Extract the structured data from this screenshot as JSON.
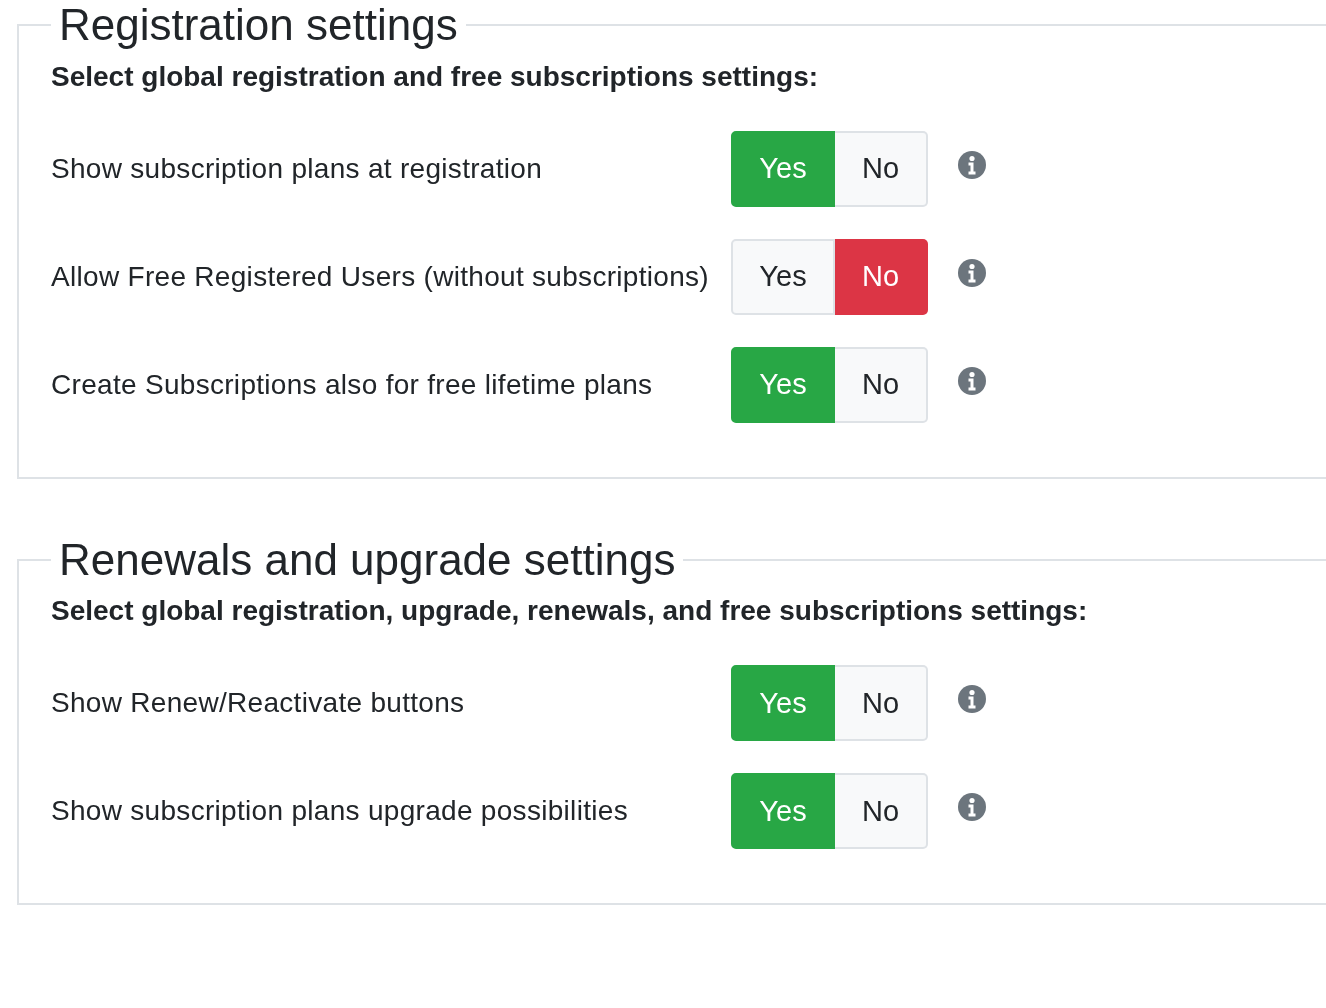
{
  "sections": [
    {
      "title": "Registration settings",
      "subtitle": "Select global registration and free subscriptions settings:",
      "settings": [
        {
          "label": "Show subscription plans at registration",
          "options": [
            {
              "label": "Yes",
              "kind": "yes",
              "selected": true
            },
            {
              "label": "No",
              "kind": "no",
              "selected": false
            }
          ]
        },
        {
          "label": "Allow Free Registered Users (without subscriptions)",
          "options": [
            {
              "label": "Yes",
              "kind": "yes",
              "selected": false
            },
            {
              "label": "No",
              "kind": "no",
              "selected": true
            }
          ]
        },
        {
          "label": "Create Subscriptions also for free lifetime plans",
          "options": [
            {
              "label": "Yes",
              "kind": "yes",
              "selected": true
            },
            {
              "label": "No",
              "kind": "no",
              "selected": false
            }
          ]
        }
      ]
    },
    {
      "title": "Renewals and upgrade settings",
      "subtitle": "Select global registration, upgrade, renewals, and free subscriptions settings:",
      "settings": [
        {
          "label": "Show Renew/Reactivate buttons",
          "options": [
            {
              "label": "Yes",
              "kind": "yes",
              "selected": true
            },
            {
              "label": "No",
              "kind": "no",
              "selected": false
            }
          ]
        },
        {
          "label": "Show subscription plans upgrade possibilities",
          "options": [
            {
              "label": "Yes",
              "kind": "yes",
              "selected": true
            },
            {
              "label": "No",
              "kind": "no",
              "selected": false
            }
          ]
        }
      ]
    }
  ]
}
